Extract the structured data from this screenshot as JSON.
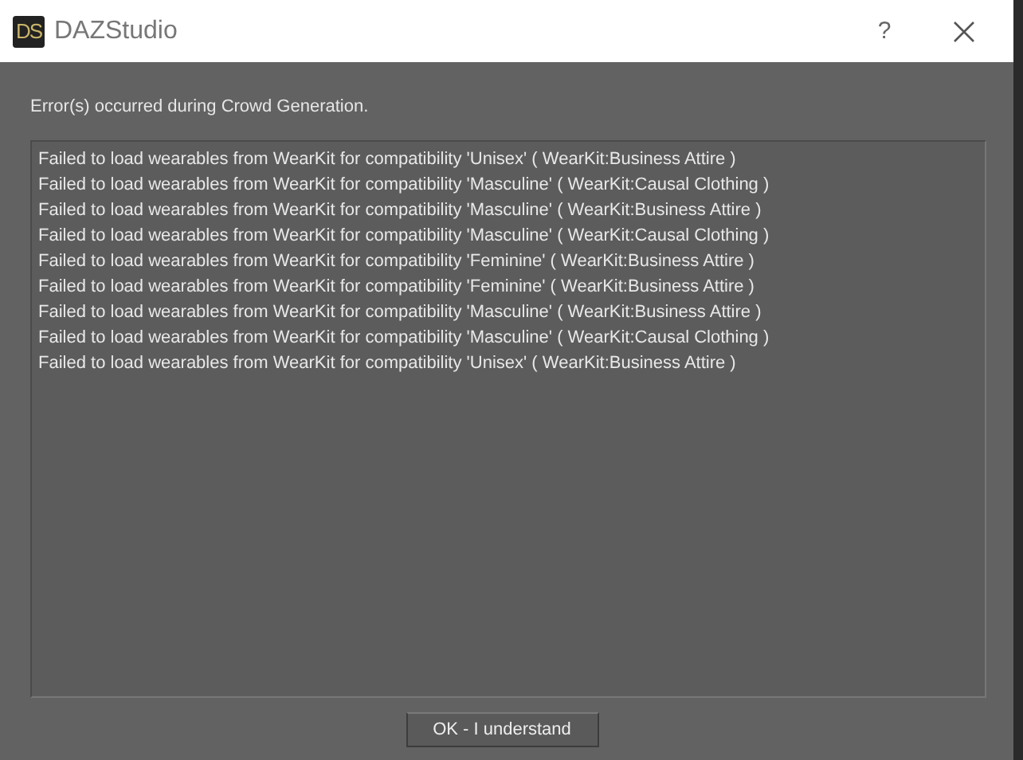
{
  "window": {
    "logo": "DS",
    "title": "DAZStudio",
    "help": "?"
  },
  "message": "Error(s) occurred during Crowd Generation.",
  "log_lines": [
    "Failed to load wearables from WearKit for compatibility 'Unisex' ( WearKit:Business Attire )",
    "Failed to load wearables from WearKit for compatibility 'Masculine' ( WearKit:Causal Clothing )",
    "Failed to load wearables from WearKit for compatibility 'Masculine' ( WearKit:Business Attire )",
    "Failed to load wearables from WearKit for compatibility 'Masculine' ( WearKit:Causal Clothing )",
    "Failed to load wearables from WearKit for compatibility 'Feminine' ( WearKit:Business Attire )",
    "Failed to load wearables from WearKit for compatibility 'Feminine' ( WearKit:Business Attire )",
    "Failed to load wearables from WearKit for compatibility 'Masculine' ( WearKit:Business Attire )",
    "Failed to load wearables from WearKit for compatibility 'Masculine' ( WearKit:Causal Clothing )",
    "Failed to load wearables from WearKit for compatibility 'Unisex' ( WearKit:Business Attire )"
  ],
  "buttons": [
    "OK - I understand"
  ]
}
